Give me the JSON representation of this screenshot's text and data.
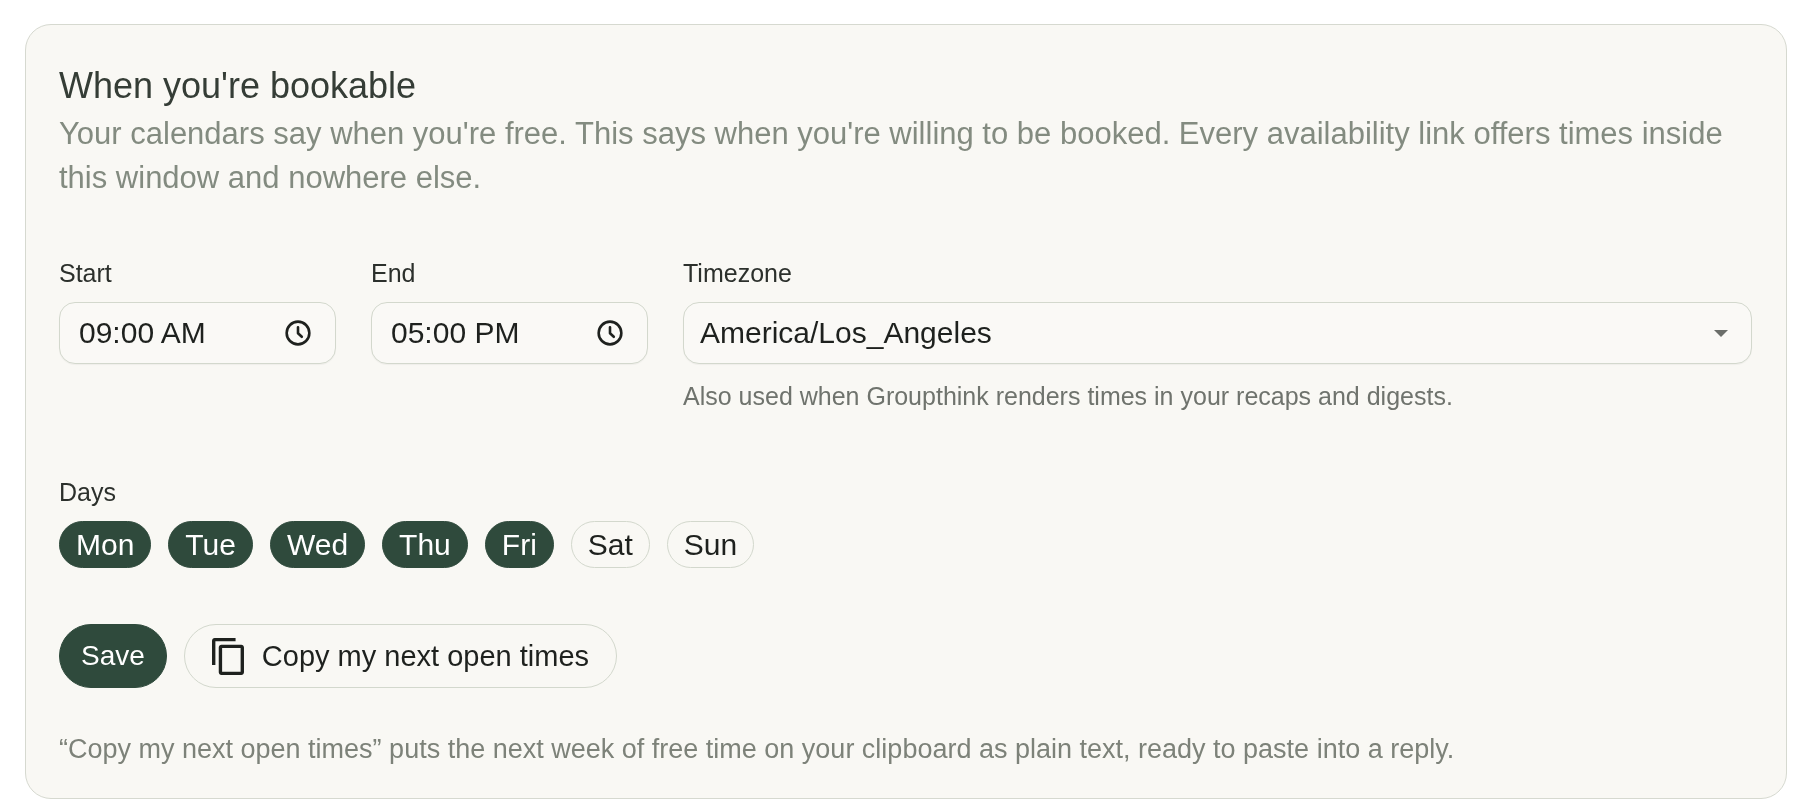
{
  "card": {
    "title": "When you're bookable",
    "description": "Your calendars say when you're free. This says when you're willing to be booked. Every availability link offers times inside this window and nowhere else."
  },
  "fields": [
    {
      "kind": "time",
      "label": "Start",
      "value": "09:00 AM"
    },
    {
      "kind": "time",
      "label": "End",
      "value": "05:00 PM"
    },
    {
      "kind": "select",
      "label": "Timezone",
      "value": "America/Los_Angeles",
      "hint": "Also used when Groupthink renders times in your recaps and digests."
    }
  ],
  "days": {
    "label": "Days",
    "items": [
      {
        "label": "Mon",
        "selected": true
      },
      {
        "label": "Tue",
        "selected": true
      },
      {
        "label": "Wed",
        "selected": true
      },
      {
        "label": "Thu",
        "selected": true
      },
      {
        "label": "Fri",
        "selected": true
      },
      {
        "label": "Sat",
        "selected": false
      },
      {
        "label": "Sun",
        "selected": false
      }
    ]
  },
  "buttons": [
    {
      "kind": "primary",
      "label": "Save"
    },
    {
      "kind": "copy",
      "label": "Copy my next open times"
    }
  ],
  "footnote": "“Copy my next open times” puts the next week of free time on your clipboard as plain text, ready to paste into a reply."
}
